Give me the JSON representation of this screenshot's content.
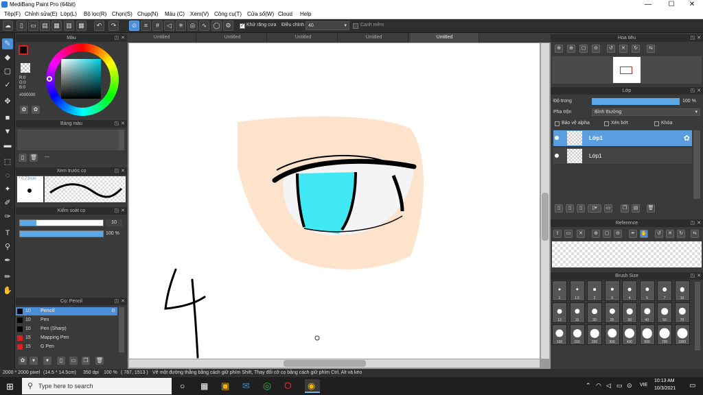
{
  "window": {
    "title": "MediBang Paint Pro (64bit)",
    "min": "—",
    "max": "☐",
    "close": "✕"
  },
  "menu": [
    "Tệp(F)",
    "Chỉnh sửa(E)",
    "Lớp(L)",
    "Bộ lọc(R)",
    "Chọn(S)",
    "Chụp(N)",
    "Màu (C)",
    "Xem(V)",
    "Công cụ(T)",
    "Cửa sổ(W)",
    "Cloud",
    "Help"
  ],
  "toolbar": {
    "antialias_label": "Khử răng cưa",
    "adjust_label": "Điều chỉnh",
    "adjust_value": "40",
    "smooth_label": "Canh mềm"
  },
  "panels": {
    "color": {
      "title": "Màu",
      "r": "R:0",
      "g": "G:0",
      "b": "B:0",
      "hex": "#000000"
    },
    "palette": {
      "title": "Bảng màu",
      "value": "---"
    },
    "brush_preview": {
      "title": "Xem trước cọ",
      "size": "* 0.73mm"
    },
    "brush_control": {
      "title": "Kiểm soát cọ",
      "size_value": "10",
      "opacity_value": "100 %",
      "size_fill": 0.2,
      "opacity_fill": 1.0
    },
    "brush_list": {
      "title": "Cọ: Pencil",
      "items": [
        {
          "size": "10",
          "name": "Pencil",
          "color": "#000000",
          "selected": true
        },
        {
          "size": "10",
          "name": "Pen",
          "color": "#000000",
          "selected": false
        },
        {
          "size": "10",
          "name": "Pen (Sharp)",
          "color": "#000000",
          "selected": false
        },
        {
          "size": "15",
          "name": "Mapping Pen",
          "color": "#e02020",
          "selected": false
        },
        {
          "size": "15",
          "name": "G Pen",
          "color": "#e02020",
          "selected": false
        }
      ]
    },
    "navigator": {
      "title": "Hoa tiêu"
    },
    "layer": {
      "title": "Lớp",
      "opacity_label": "Độ trong",
      "opacity_value": "100 %",
      "opacity_fill": 1.0,
      "blend_label": "Pha trộn",
      "blend_value": "Bình thường",
      "protect_alpha": "Bảo vệ alpha",
      "clip": "Xén bớt",
      "lock": "Khóa",
      "layers": [
        {
          "name": "Lớp1",
          "selected": true
        },
        {
          "name": "Lớp1",
          "selected": false
        }
      ]
    },
    "reference": {
      "title": "Reference"
    },
    "brush_size": {
      "title": "Brush Size",
      "sizes": [
        "1",
        "1.5",
        "2",
        "3",
        "4",
        "5",
        "7",
        "10",
        "12",
        "15",
        "20",
        "25",
        "30",
        "40",
        "50",
        "70",
        "100",
        "150",
        "200",
        "300",
        "400",
        "500",
        "700",
        "1000"
      ]
    }
  },
  "doc_tabs": [
    "Untitled",
    "Untitled",
    "Untitled",
    "Untitled",
    "Untitled"
  ],
  "status": {
    "dimensions": "2000 * 2000 pixel",
    "size_mm": "(14.5 * 14.5cm)",
    "dpi": "350 dpi",
    "zoom": "100 %",
    "coords": "( 787, 1513 )",
    "hint": "Vẽ một đường thẳng bằng cách giữ phím Shift, Thay đổi cỡ cọ bằng cách giữ phím Ctrl, Alt và kéo"
  },
  "canvas": {
    "handwritten_digit": "4"
  },
  "taskbar": {
    "search_placeholder": "Type here to search",
    "time": "10:13 AM",
    "date": "10/3/2021",
    "lang": "VIE"
  }
}
